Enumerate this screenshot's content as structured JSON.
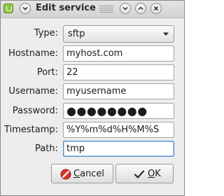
{
  "window": {
    "title": "Edit service"
  },
  "form": {
    "type": {
      "label": "Type:",
      "value": "sftp"
    },
    "hostname": {
      "label": "Hostname:",
      "value": "myhost.com"
    },
    "port": {
      "label": "Port:",
      "value": "22"
    },
    "username": {
      "label": "Username:",
      "value": "myusername"
    },
    "password": {
      "label": "Password:",
      "masked_value": "●●●●●●●●"
    },
    "timestamp": {
      "label": "Timestamp:",
      "value": "%Y%m%d%H%M%S"
    },
    "path": {
      "label": "Path:",
      "value": "tmp"
    }
  },
  "buttons": {
    "cancel": {
      "mnemonic": "C",
      "rest": "ancel"
    },
    "ok": {
      "mnemonic": "O",
      "rest": "K"
    }
  },
  "icons": {
    "app": "mint-app-icon",
    "menu": "chevron-down-icon",
    "minimize": "minimize-icon",
    "maximize": "maximize-icon",
    "close": "close-icon",
    "cancel": "cancel-icon",
    "ok": "checkmark-icon"
  },
  "colors": {
    "app_icon": "#8cc63f",
    "cancel_icon": "#d6332a",
    "focus_border": "#5b8fd3"
  }
}
